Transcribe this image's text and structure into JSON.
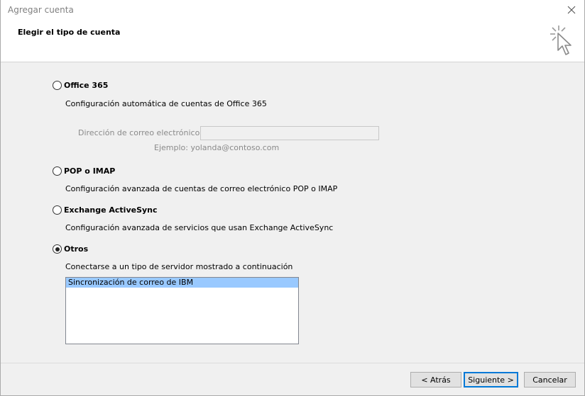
{
  "window": {
    "title": "Agregar cuenta"
  },
  "header": {
    "title": "Elegir el tipo de cuenta"
  },
  "options": {
    "office365": {
      "label": "Office 365",
      "description": "Configuración automática de cuentas de Office 365",
      "email_label": "Dirección de correo electrónico:",
      "email_value": "",
      "email_example": "Ejemplo: yolanda@contoso.com",
      "checked": false
    },
    "pop_imap": {
      "label": "POP o IMAP",
      "description": "Configuración avanzada de cuentas de correo electrónico POP o IMAP",
      "checked": false
    },
    "activesync": {
      "label": "Exchange ActiveSync",
      "description": "Configuración avanzada de servicios que usan Exchange ActiveSync",
      "checked": false
    },
    "otros": {
      "label": "Otros",
      "description": "Conectarse a un tipo de servidor mostrado a continuación",
      "checked": true,
      "list_items": [
        "Sincronización de correo de IBM"
      ],
      "selected_index": 0
    }
  },
  "footer": {
    "back_label": "< Atrás",
    "next_label": "Siguiente >",
    "cancel_label": "Cancelar"
  },
  "colors": {
    "selection": "#99c9ff",
    "default_button_border": "#0078d7"
  },
  "icons": {
    "close": "close-icon",
    "header_art": "cursor-sparkle-icon"
  }
}
